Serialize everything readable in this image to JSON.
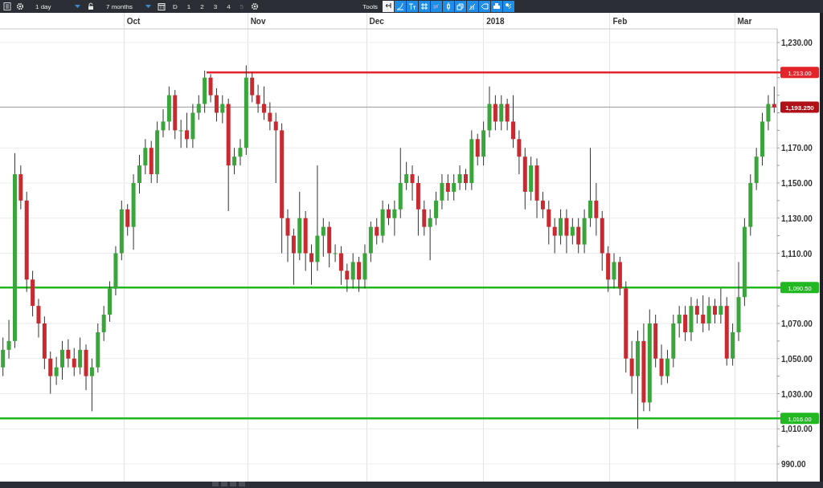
{
  "toolbar": {
    "interval": "1 day",
    "range": "7 months",
    "presets": [
      {
        "label": "D",
        "disabled": false
      },
      {
        "label": "1",
        "disabled": false
      },
      {
        "label": "2",
        "disabled": false
      },
      {
        "label": "3",
        "disabled": false
      },
      {
        "label": "4",
        "disabled": false
      },
      {
        "label": "5",
        "disabled": true
      }
    ],
    "tools_label": "Tools"
  },
  "chart": {
    "chart_data": {
      "type": "candlestick",
      "categories": [
        null,
        null,
        null,
        null,
        null,
        null,
        null,
        null,
        null,
        null,
        null,
        null,
        null,
        null,
        null,
        null,
        null,
        null,
        null,
        null,
        null,
        null,
        "Oct",
        null,
        null,
        null,
        null,
        null,
        null,
        null,
        null,
        null,
        null,
        null,
        null,
        null,
        null,
        null,
        null,
        null,
        null,
        null,
        null,
        "Nov",
        null,
        null,
        null,
        null,
        null,
        null,
        null,
        null,
        null,
        null,
        null,
        null,
        null,
        null,
        null,
        null,
        null,
        null,
        null,
        "Dec",
        null,
        null,
        null,
        null,
        null,
        null,
        null,
        null,
        null,
        null,
        null,
        null,
        null,
        null,
        null,
        null,
        null,
        null,
        null,
        "2018",
        null,
        null,
        null,
        null,
        null,
        null,
        null,
        null,
        null,
        null,
        null,
        null,
        null,
        null,
        null,
        null,
        null,
        null,
        null,
        null,
        "Feb",
        null,
        null,
        null,
        null,
        null,
        null,
        null,
        null,
        null,
        null,
        null,
        null,
        null,
        null,
        null,
        null,
        null,
        null,
        null,
        null,
        "Mar",
        null,
        null,
        null,
        null,
        null
      ],
      "ohlc": [
        [
          1045,
          1062,
          1040,
          1055
        ],
        [
          1055,
          1072,
          1050,
          1060
        ],
        [
          1060,
          1167,
          1056,
          1155
        ],
        [
          1155,
          1160,
          1135,
          1140
        ],
        [
          1140,
          1145,
          1088,
          1095
        ],
        [
          1095,
          1100,
          1074,
          1080
        ],
        [
          1080,
          1084,
          1062,
          1070
        ],
        [
          1070,
          1074,
          1044,
          1050
        ],
        [
          1050,
          1054,
          1030,
          1040
        ],
        [
          1040,
          1051,
          1035,
          1045
        ],
        [
          1045,
          1060,
          1038,
          1055
        ],
        [
          1055,
          1061,
          1045,
          1050
        ],
        [
          1050,
          1056,
          1040,
          1045
        ],
        [
          1045,
          1062,
          1041,
          1055
        ],
        [
          1055,
          1058,
          1032,
          1040
        ],
        [
          1040,
          1050,
          1020,
          1045
        ],
        [
          1045,
          1070,
          1042,
          1065
        ],
        [
          1065,
          1080,
          1060,
          1075
        ],
        [
          1075,
          1094,
          1071,
          1090
        ],
        [
          1090,
          1114,
          1086,
          1110
        ],
        [
          1110,
          1140,
          1106,
          1135
        ],
        [
          1135,
          1138,
          1120,
          1125
        ],
        [
          1125,
          1155,
          1112,
          1150
        ],
        [
          1150,
          1166,
          1144,
          1160
        ],
        [
          1160,
          1175,
          1155,
          1170
        ],
        [
          1170,
          1174,
          1150,
          1155
        ],
        [
          1155,
          1185,
          1150,
          1180
        ],
        [
          1180,
          1192,
          1176,
          1185
        ],
        [
          1185,
          1205,
          1180,
          1200
        ],
        [
          1200,
          1203,
          1175,
          1180
        ],
        [
          1180,
          1186,
          1170,
          1180
        ],
        [
          1180,
          1190,
          1170,
          1175
        ],
        [
          1175,
          1195,
          1170,
          1190
        ],
        [
          1190,
          1200,
          1186,
          1195
        ],
        [
          1195,
          1214,
          1190,
          1210
        ],
        [
          1210,
          1212,
          1196,
          1200
        ],
        [
          1200,
          1204,
          1185,
          1190
        ],
        [
          1190,
          1200,
          1184,
          1195
        ],
        [
          1195,
          1198,
          1134,
          1160
        ],
        [
          1160,
          1170,
          1155,
          1165
        ],
        [
          1165,
          1175,
          1160,
          1170
        ],
        [
          1170,
          1217,
          1166,
          1210
        ],
        [
          1210,
          1213,
          1196,
          1200
        ],
        [
          1200,
          1206,
          1190,
          1195
        ],
        [
          1195,
          1205,
          1186,
          1190
        ],
        [
          1190,
          1196,
          1180,
          1185
        ],
        [
          1185,
          1190,
          1150,
          1180
        ],
        [
          1180,
          1184,
          1110,
          1130
        ],
        [
          1130,
          1135,
          1105,
          1120
        ],
        [
          1120,
          1124,
          1092,
          1110
        ],
        [
          1110,
          1145,
          1106,
          1130
        ],
        [
          1130,
          1134,
          1100,
          1110
        ],
        [
          1110,
          1115,
          1092,
          1105
        ],
        [
          1105,
          1160,
          1100,
          1120
        ],
        [
          1120,
          1130,
          1108,
          1125
        ],
        [
          1125,
          1128,
          1102,
          1110
        ],
        [
          1110,
          1115,
          1105,
          1110
        ],
        [
          1110,
          1114,
          1092,
          1100
        ],
        [
          1100,
          1104,
          1088,
          1095
        ],
        [
          1095,
          1110,
          1090,
          1105
        ],
        [
          1105,
          1108,
          1088,
          1095
        ],
        [
          1095,
          1115,
          1090,
          1110
        ],
        [
          1110,
          1128,
          1105,
          1125
        ],
        [
          1125,
          1130,
          1115,
          1120
        ],
        [
          1120,
          1140,
          1116,
          1135
        ],
        [
          1135,
          1138,
          1126,
          1130
        ],
        [
          1130,
          1140,
          1120,
          1135
        ],
        [
          1135,
          1170,
          1130,
          1150
        ],
        [
          1150,
          1162,
          1146,
          1155
        ],
        [
          1155,
          1160,
          1140,
          1150
        ],
        [
          1150,
          1154,
          1120,
          1135
        ],
        [
          1135,
          1140,
          1120,
          1125
        ],
        [
          1125,
          1135,
          1106,
          1130
        ],
        [
          1130,
          1145,
          1126,
          1140
        ],
        [
          1140,
          1155,
          1135,
          1150
        ],
        [
          1150,
          1155,
          1140,
          1145
        ],
        [
          1145,
          1155,
          1140,
          1150
        ],
        [
          1150,
          1160,
          1146,
          1155
        ],
        [
          1155,
          1158,
          1146,
          1150
        ],
        [
          1150,
          1180,
          1146,
          1175
        ],
        [
          1175,
          1178,
          1160,
          1165
        ],
        [
          1165,
          1185,
          1160,
          1180
        ],
        [
          1180,
          1205,
          1176,
          1195
        ],
        [
          1195,
          1200,
          1180,
          1185
        ],
        [
          1185,
          1200,
          1180,
          1195
        ],
        [
          1195,
          1198,
          1180,
          1185
        ],
        [
          1185,
          1200,
          1170,
          1175
        ],
        [
          1175,
          1180,
          1155,
          1165
        ],
        [
          1165,
          1170,
          1135,
          1145
        ],
        [
          1145,
          1165,
          1140,
          1160
        ],
        [
          1160,
          1164,
          1130,
          1140
        ],
        [
          1140,
          1145,
          1130,
          1135
        ],
        [
          1135,
          1140,
          1115,
          1125
        ],
        [
          1125,
          1130,
          1110,
          1120
        ],
        [
          1120,
          1135,
          1115,
          1130
        ],
        [
          1130,
          1135,
          1110,
          1120
        ],
        [
          1120,
          1130,
          1115,
          1125
        ],
        [
          1125,
          1130,
          1110,
          1115
        ],
        [
          1115,
          1135,
          1110,
          1130
        ],
        [
          1130,
          1170,
          1125,
          1140
        ],
        [
          1140,
          1150,
          1120,
          1130
        ],
        [
          1130,
          1134,
          1100,
          1110
        ],
        [
          1110,
          1114,
          1088,
          1095
        ],
        [
          1095,
          1110,
          1090,
          1105
        ],
        [
          1105,
          1108,
          1086,
          1090
        ],
        [
          1090,
          1094,
          1042,
          1050
        ],
        [
          1050,
          1060,
          1030,
          1040
        ],
        [
          1040,
          1066,
          1010,
          1060
        ],
        [
          1060,
          1070,
          1020,
          1025
        ],
        [
          1025,
          1078,
          1020,
          1070
        ],
        [
          1070,
          1075,
          1045,
          1050
        ],
        [
          1050,
          1058,
          1035,
          1040
        ],
        [
          1040,
          1055,
          1036,
          1050
        ],
        [
          1050,
          1075,
          1045,
          1070
        ],
        [
          1070,
          1080,
          1062,
          1075
        ],
        [
          1075,
          1080,
          1060,
          1065
        ],
        [
          1065,
          1085,
          1060,
          1080
        ],
        [
          1080,
          1084,
          1070,
          1075
        ],
        [
          1075,
          1086,
          1065,
          1070
        ],
        [
          1070,
          1085,
          1066,
          1080
        ],
        [
          1080,
          1084,
          1070,
          1075
        ],
        [
          1075,
          1090,
          1070,
          1080
        ],
        [
          1080,
          1085,
          1046,
          1050
        ],
        [
          1050,
          1070,
          1046,
          1065
        ],
        [
          1065,
          1105,
          1060,
          1085
        ],
        [
          1085,
          1130,
          1080,
          1125
        ],
        [
          1125,
          1155,
          1120,
          1150
        ],
        [
          1150,
          1170,
          1146,
          1165
        ],
        [
          1165,
          1190,
          1160,
          1185
        ],
        [
          1185,
          1200,
          1180,
          1195
        ],
        [
          1195,
          1205,
          1190,
          1193
        ]
      ],
      "ylim": [
        990,
        1230
      ],
      "grid": true,
      "ref_lines": [
        {
          "axis": "y",
          "value": 1213,
          "label": "1,213.00",
          "color": "#e3242b"
        },
        {
          "axis": "y",
          "value": 1090.5,
          "label": "1,090.50",
          "color": "#22b822"
        },
        {
          "axis": "y",
          "value": 1016,
          "label": "1,016.00",
          "color": "#22b822"
        },
        {
          "axis": "y",
          "value": 1193.25,
          "color": "#9a9a9a"
        }
      ],
      "yticks": [
        {
          "value": 1230,
          "label": "1,230.00"
        },
        {
          "value": 1170,
          "label": "1,170.00"
        },
        {
          "value": 1150,
          "label": "1,150.00"
        },
        {
          "value": 1130,
          "label": "1,130.00"
        },
        {
          "value": 1110,
          "label": "1,110.00"
        },
        {
          "value": 1070,
          "label": "1,070.00"
        },
        {
          "value": 1050,
          "label": "1,050.00"
        },
        {
          "value": 1030,
          "label": "1,030.00"
        },
        {
          "value": 1010,
          "label": "1,010.00"
        },
        {
          "value": 990,
          "label": "990.00"
        }
      ]
    },
    "current_price": {
      "label": "1,193.250",
      "color": "#b01018"
    }
  }
}
